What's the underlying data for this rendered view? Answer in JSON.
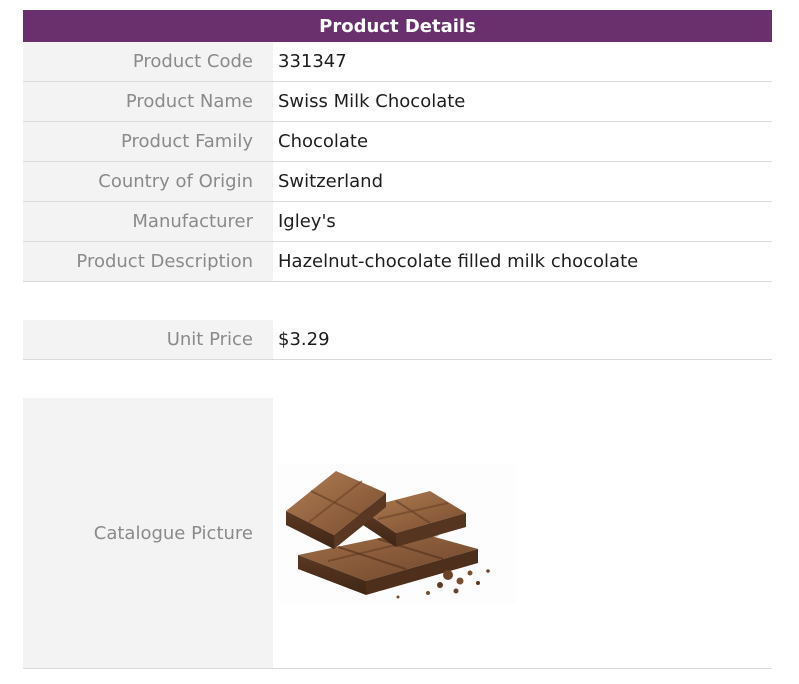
{
  "header": {
    "title": "Product Details"
  },
  "details": [
    {
      "label": "Product Code",
      "value": "331347"
    },
    {
      "label": "Product Name",
      "value": "Swiss Milk Chocolate"
    },
    {
      "label": "Product Family",
      "value": "Chocolate"
    },
    {
      "label": "Country of Origin",
      "value": "Switzerland"
    },
    {
      "label": "Manufacturer",
      "value": "Igley's"
    },
    {
      "label": "Product Description",
      "value": "Hazelnut-chocolate filled milk chocolate"
    }
  ],
  "price": {
    "label": "Unit Price",
    "value": "$3.29"
  },
  "picture": {
    "label": "Catalogue Picture",
    "subject": "chocolate-pieces"
  },
  "colors": {
    "header_bg": "#69306d",
    "header_text": "#ffffff",
    "label_bg": "#f3f3f3",
    "label_text": "#8a8a8a",
    "value_text": "#1e1e1e",
    "row_border": "#dadada"
  }
}
